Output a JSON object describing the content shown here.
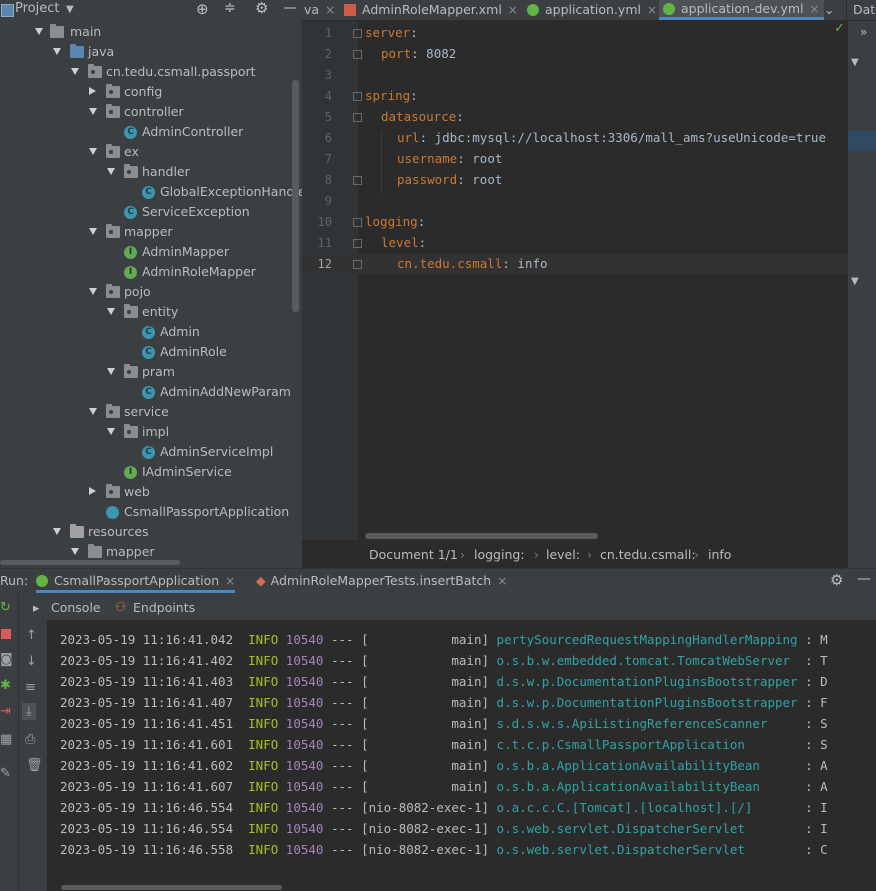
{
  "project": {
    "title": "Project",
    "tree": [
      {
        "label": "main"
      },
      {
        "label": "java"
      },
      {
        "label": "cn.tedu.csmall.passport"
      },
      {
        "label": "config"
      },
      {
        "label": "controller"
      },
      {
        "label": "AdminController"
      },
      {
        "label": "ex"
      },
      {
        "label": "handler"
      },
      {
        "label": "GlobalExceptionHandler"
      },
      {
        "label": "ServiceException"
      },
      {
        "label": "mapper"
      },
      {
        "label": "AdminMapper"
      },
      {
        "label": "AdminRoleMapper"
      },
      {
        "label": "pojo"
      },
      {
        "label": "entity"
      },
      {
        "label": "Admin"
      },
      {
        "label": "AdminRole"
      },
      {
        "label": "pram"
      },
      {
        "label": "AdminAddNewParam"
      },
      {
        "label": "service"
      },
      {
        "label": "impl"
      },
      {
        "label": "AdminServiceImpl"
      },
      {
        "label": "IAdminService"
      },
      {
        "label": "web"
      },
      {
        "label": "CsmallPassportApplication"
      },
      {
        "label": "resources"
      },
      {
        "label": "mapper"
      }
    ]
  },
  "editor_tabs": [
    {
      "label": "va"
    },
    {
      "label": "AdminRoleMapper.xml"
    },
    {
      "label": "application.yml"
    },
    {
      "label": "application-dev.yml"
    },
    {
      "label": "Data"
    }
  ],
  "editor": {
    "lines": [
      {
        "num": "1",
        "key": "server",
        "sep": ":",
        "val": ""
      },
      {
        "num": "2",
        "key": "port",
        "sep": ":",
        "val": " 8082"
      },
      {
        "num": "3",
        "key": "",
        "sep": "",
        "val": ""
      },
      {
        "num": "4",
        "key": "spring",
        "sep": ":",
        "val": ""
      },
      {
        "num": "5",
        "key": "datasource",
        "sep": ":",
        "val": ""
      },
      {
        "num": "6",
        "key": "url",
        "sep": ":",
        "val": " jdbc:mysql://localhost:3306/mall_ams?useUnicode=true"
      },
      {
        "num": "7",
        "key": "username",
        "sep": ":",
        "val": " root"
      },
      {
        "num": "8",
        "key": "password",
        "sep": ":",
        "val": " root"
      },
      {
        "num": "9",
        "key": "",
        "sep": "",
        "val": ""
      },
      {
        "num": "10",
        "key": "logging",
        "sep": ":",
        "val": ""
      },
      {
        "num": "11",
        "key": "level",
        "sep": ":",
        "val": ""
      },
      {
        "num": "12",
        "key": "cn.tedu.csmall",
        "sep": ":",
        "val": " info"
      }
    ]
  },
  "breadcrumb": [
    "Document 1/1",
    "logging:",
    "level:",
    "cn.tedu.csmall:",
    "info"
  ],
  "run": {
    "label": "Run:",
    "tabs": [
      "CsmallPassportApplication",
      "AdminRoleMapperTests.insertBatch"
    ],
    "sub_tabs": [
      "Console",
      "Endpoints"
    ]
  },
  "console": {
    "lines": [
      {
        "ts": "2023-05-19 11:16:41.042",
        "level": "INFO",
        "pid": "10540",
        "sep": "---",
        "thread": "[           main]",
        "logger": "pertySourcedRequestMappingHandlerMapping",
        "tail": ": M"
      },
      {
        "ts": "2023-05-19 11:16:41.402",
        "level": "INFO",
        "pid": "10540",
        "sep": "---",
        "thread": "[           main]",
        "logger": "o.s.b.w.embedded.tomcat.TomcatWebServer ",
        "tail": " : T"
      },
      {
        "ts": "2023-05-19 11:16:41.403",
        "level": "INFO",
        "pid": "10540",
        "sep": "---",
        "thread": "[           main]",
        "logger": "d.s.w.p.DocumentationPluginsBootstrapper",
        "tail": " : D"
      },
      {
        "ts": "2023-05-19 11:16:41.407",
        "level": "INFO",
        "pid": "10540",
        "sep": "---",
        "thread": "[           main]",
        "logger": "d.s.w.p.DocumentationPluginsBootstrapper",
        "tail": " : F"
      },
      {
        "ts": "2023-05-19 11:16:41.451",
        "level": "INFO",
        "pid": "10540",
        "sep": "---",
        "thread": "[           main]",
        "logger": "s.d.s.w.s.ApiListingReferenceScanner    ",
        "tail": " : S"
      },
      {
        "ts": "2023-05-19 11:16:41.601",
        "level": "INFO",
        "pid": "10540",
        "sep": "---",
        "thread": "[           main]",
        "logger": "c.t.c.p.CsmallPassportApplication       ",
        "tail": " : S"
      },
      {
        "ts": "2023-05-19 11:16:41.602",
        "level": "INFO",
        "pid": "10540",
        "sep": "---",
        "thread": "[           main]",
        "logger": "o.s.b.a.ApplicationAvailabilityBean     ",
        "tail": " : A"
      },
      {
        "ts": "2023-05-19 11:16:41.607",
        "level": "INFO",
        "pid": "10540",
        "sep": "---",
        "thread": "[           main]",
        "logger": "o.s.b.a.ApplicationAvailabilityBean     ",
        "tail": " : A"
      },
      {
        "ts": "2023-05-19 11:16:46.554",
        "level": "INFO",
        "pid": "10540",
        "sep": "---",
        "thread": "[nio-8082-exec-1]",
        "logger": "o.a.c.c.C.[Tomcat].[localhost].[/]      ",
        "tail": " : I"
      },
      {
        "ts": "2023-05-19 11:16:46.554",
        "level": "INFO",
        "pid": "10540",
        "sep": "---",
        "thread": "[nio-8082-exec-1]",
        "logger": "o.s.web.servlet.DispatcherServlet       ",
        "tail": " : I"
      },
      {
        "ts": "2023-05-19 11:16:46.558",
        "level": "INFO",
        "pid": "10540",
        "sep": "---",
        "thread": "[nio-8082-exec-1]",
        "logger": "o.s.web.servlet.DispatcherServlet       ",
        "tail": " : C"
      }
    ]
  },
  "colors": {
    "keyword": "#cc7832",
    "info": "#a8c023",
    "pid": "#a385b8",
    "logger": "#30a3a3",
    "active_tab_underline": "#4a88c7"
  }
}
